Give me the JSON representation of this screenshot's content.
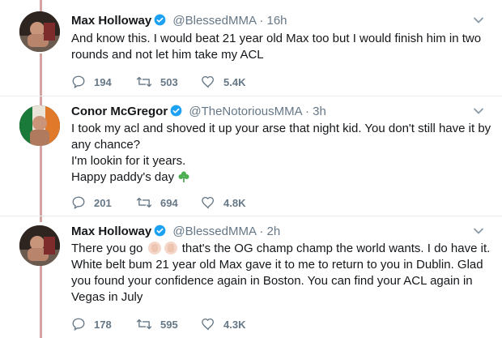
{
  "tweets": [
    {
      "name": "Max Holloway",
      "handle": "@BlessedMMA",
      "dot": "·",
      "time": "16h",
      "lines": [
        "And know this. I would beat 21 year old Max too but I would finish him in two",
        "rounds and not let him take my ACL"
      ],
      "replies": "194",
      "retweets": "503",
      "likes": "5.4K"
    },
    {
      "name": "Conor McGregor",
      "handle": "@TheNotoriousMMA",
      "dot": "·",
      "time": "3h",
      "lines": [
        "I took my acl and shoved it up your arse that night kid. You don't still have it by",
        "any chance?",
        "I'm lookin for it years.",
        "Happy paddy's day"
      ],
      "replies": "201",
      "retweets": "694",
      "likes": "4.8K"
    },
    {
      "name": "Max Holloway",
      "handle": "@BlessedMMA",
      "dot": "·",
      "time": "2h",
      "line1_pre": "There you go",
      "line1_post": "that's the OG champ champ the world wants. I do have it.",
      "lines": [
        "White belt bum 21 year old Max gave it to me to return to you in Dublin. Glad",
        "you found your confidence again in Boston. You can find your ACL again in",
        "Vegas in July"
      ],
      "replies": "178",
      "retweets": "595",
      "likes": "4.3K"
    }
  ],
  "colors": {
    "thread_line": "#d6a3a3",
    "verified": "#1da1f2",
    "secondary_text": "#657786",
    "divider": "#e6ecf0"
  },
  "icons": [
    "verified-badge-icon",
    "caret-down-icon",
    "reply-icon",
    "retweet-icon",
    "like-icon",
    "clap-emoji-icon",
    "shamrock-emoji-icon"
  ]
}
